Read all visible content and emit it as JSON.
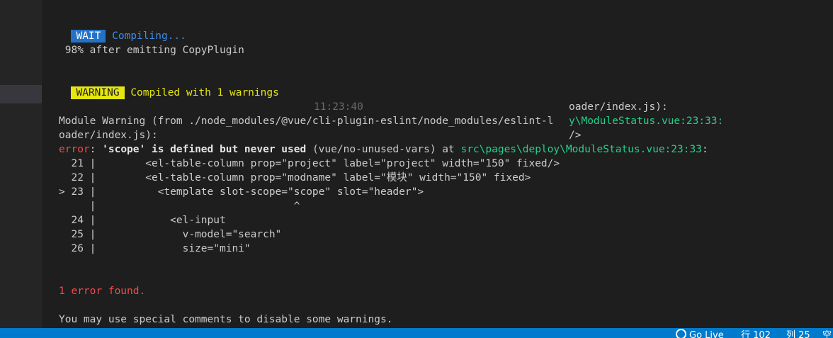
{
  "terminal": {
    "wait_badge": "WAIT",
    "compiling": "Compiling...",
    "progress": " 98% after emitting CopyPlugin",
    "warning_badge": "WARNING",
    "compiled": "Compiled with 1 warnings",
    "timestamp": "11:23:40",
    "overlap_line1": "oader/index.js):",
    "overlap_line2": "y\\ModuleStatus.vue:23:33:",
    "overlap_line3": "/>",
    "module_warning": "Module Warning (from ./node_modules/@vue/cli-plugin-eslint/node_modules/eslint-l",
    "module_warning_cont": "oader/index.js):",
    "error_label": "error",
    "error_colon": ": ",
    "error_msg": "'scope' is defined but never used",
    "error_rule": " (vue/no-unused-vars) at ",
    "error_path": "src\\pages\\deploy\\ModuleStatus.vue:23:33",
    "error_path_end": ":",
    "code_lines": [
      {
        "prefix": "  21 |",
        "code": "        <el-table-column prop=\"project\" label=\"project\" width=\"150\" fixed/>"
      },
      {
        "prefix": "  22 |",
        "code": "        <el-table-column prop=\"modname\" label=\"模块\" width=\"150\" fixed>"
      },
      {
        "prefix": "> 23 |",
        "code": "          <template slot-scope=\"scope\" slot=\"header\">"
      },
      {
        "prefix": "     |",
        "code": "                                ^"
      },
      {
        "prefix": "  24 |",
        "code": "            <el-input"
      },
      {
        "prefix": "  25 |",
        "code": "              v-model=\"search\""
      },
      {
        "prefix": "  26 |",
        "code": "              size=\"mini\""
      }
    ],
    "errors_found": "1 error found.",
    "hint": "You may use special comments to disable some warnings."
  },
  "statusbar": {
    "golive": "Go Live",
    "line": "行 102",
    "col": "列 25",
    "spaces": "空"
  },
  "colors": {
    "background": "#1e1e1e",
    "statusbar": "#007acc",
    "wait_badge": "#2472c8",
    "warning_badge": "#e5e510",
    "error": "#f14c4c",
    "path": "#23d18b"
  },
  "icons": {
    "golive": "broadcast-icon"
  }
}
